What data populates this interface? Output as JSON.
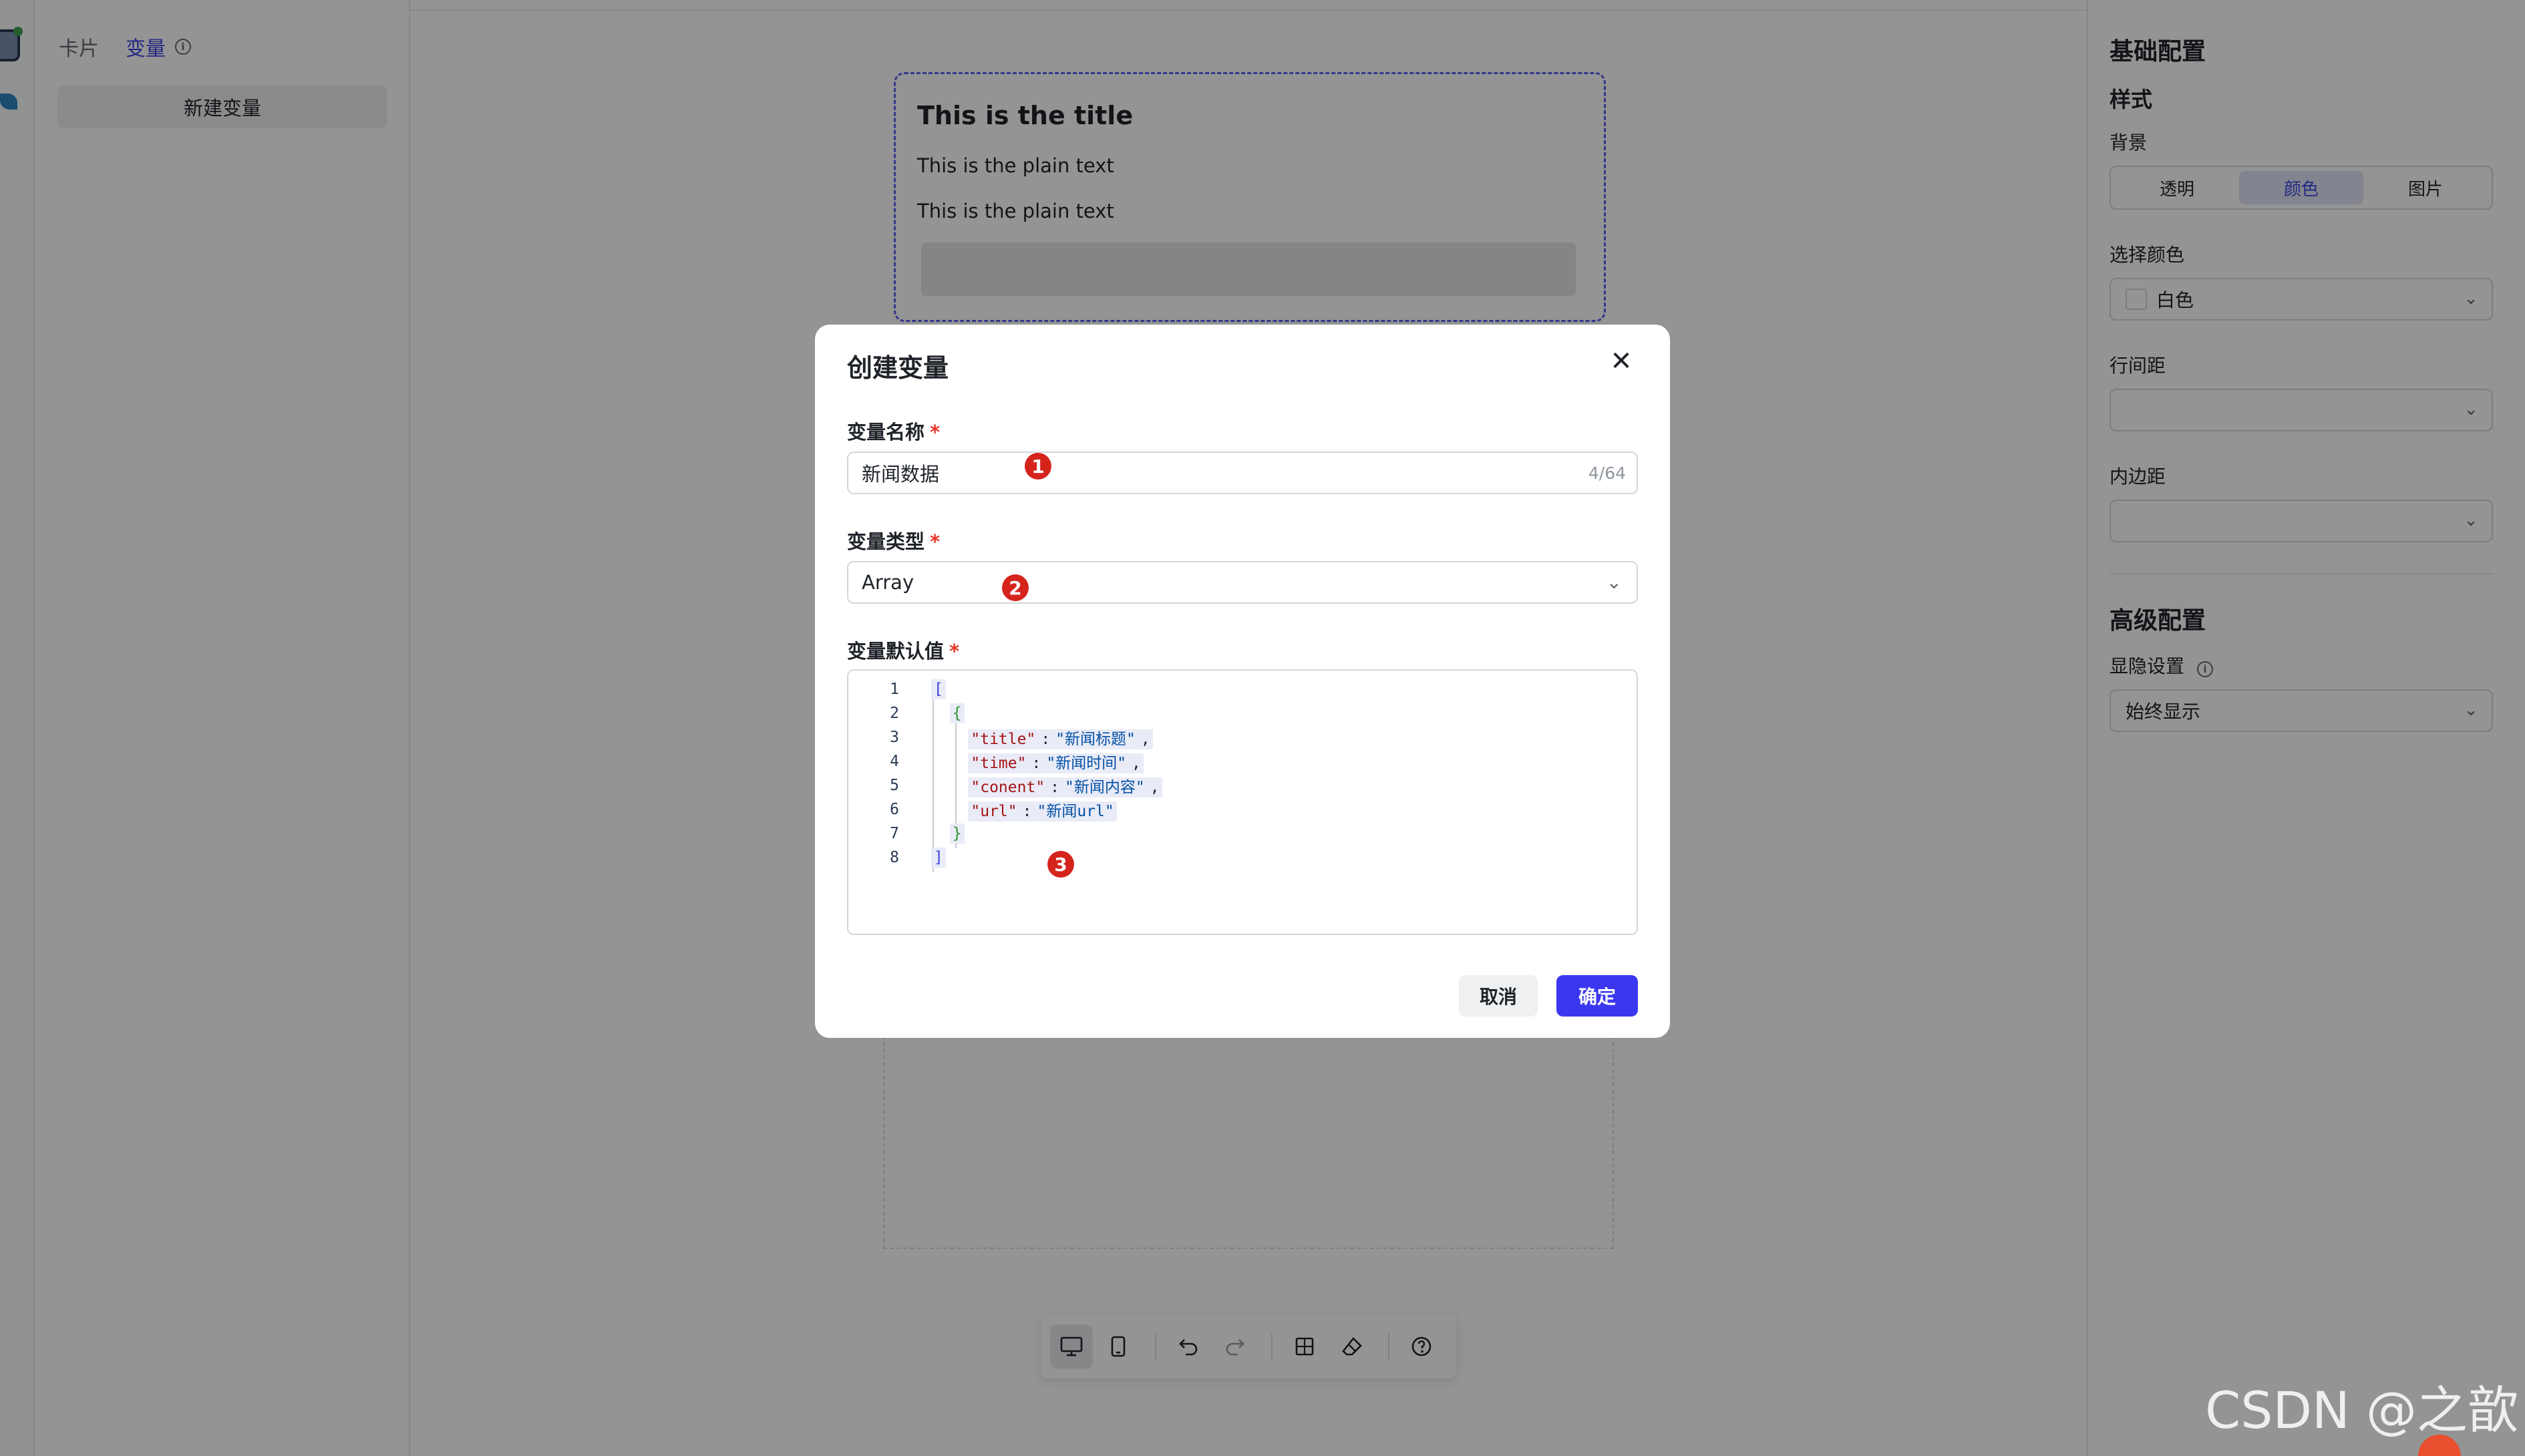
{
  "left_panel": {
    "tabs": [
      {
        "label": "卡片"
      },
      {
        "label": "变量"
      }
    ],
    "new_variable_button": "新建变量"
  },
  "card": {
    "title": "This is the title",
    "text_1": "This is the plain text",
    "text_2": "This is the plain text"
  },
  "right_panel": {
    "basic_config": "基础配置",
    "style": "样式",
    "background_label": "背景",
    "background_options": [
      "透明",
      "颜色",
      "图片"
    ],
    "background_selected": "颜色",
    "choose_color_label": "选择颜色",
    "color_value": "白色",
    "line_spacing_label": "行间距",
    "line_spacing_value": "",
    "padding_label": "内边距",
    "padding_value": "",
    "advanced_config": "高级配置",
    "visibility_label": "显隐设置",
    "visibility_value": "始终显示"
  },
  "modal": {
    "title": "创建变量",
    "name_label": "变量名称",
    "name_value": "新闻数据",
    "name_counter": "4/64",
    "type_label": "变量类型",
    "type_value": "Array",
    "default_label": "变量默认值",
    "required_mark": "*",
    "code_lines": [
      {
        "no": "1",
        "tokens": [
          {
            "t": "[",
            "c": "brk"
          }
        ]
      },
      {
        "no": "2",
        "tokens": [
          {
            "t": "  {",
            "c": "brace"
          }
        ]
      },
      {
        "no": "3",
        "tokens": [
          {
            "t": "    \"title\"",
            "c": "key"
          },
          {
            "t": ":",
            "c": "punct"
          },
          {
            "t": "\"新闻标题\"",
            "c": "str"
          },
          {
            "t": ",",
            "c": "punct"
          }
        ]
      },
      {
        "no": "4",
        "tokens": [
          {
            "t": "    \"time\"",
            "c": "key"
          },
          {
            "t": ":",
            "c": "punct"
          },
          {
            "t": "\"新闻时间\"",
            "c": "str"
          },
          {
            "t": ",",
            "c": "punct"
          }
        ]
      },
      {
        "no": "5",
        "tokens": [
          {
            "t": "    \"conent\"",
            "c": "key"
          },
          {
            "t": ":",
            "c": "punct"
          },
          {
            "t": "\"新闻内容\"",
            "c": "str"
          },
          {
            "t": ",",
            "c": "punct"
          }
        ]
      },
      {
        "no": "6",
        "tokens": [
          {
            "t": "    \"url\"",
            "c": "key"
          },
          {
            "t": ":",
            "c": "punct"
          },
          {
            "t": "\"新闻url\"",
            "c": "str"
          }
        ]
      },
      {
        "no": "7",
        "tokens": [
          {
            "t": "  }",
            "c": "brace"
          }
        ]
      },
      {
        "no": "8",
        "tokens": [
          {
            "t": "]",
            "c": "brk"
          }
        ]
      }
    ],
    "badges": [
      "1",
      "2",
      "3"
    ],
    "cancel_label": "取消",
    "ok_label": "确定"
  },
  "toolbar": {
    "icons": [
      "desktop-icon",
      "mobile-icon",
      "undo-icon",
      "redo-icon",
      "grid-icon",
      "eraser-icon",
      "help-icon"
    ]
  },
  "watermark": "CSDN @之歆",
  "colors": {
    "accent": "#3b37f0",
    "active_tab": "#3b45e0",
    "required": "#e5352b",
    "badge": "#d4241c"
  }
}
